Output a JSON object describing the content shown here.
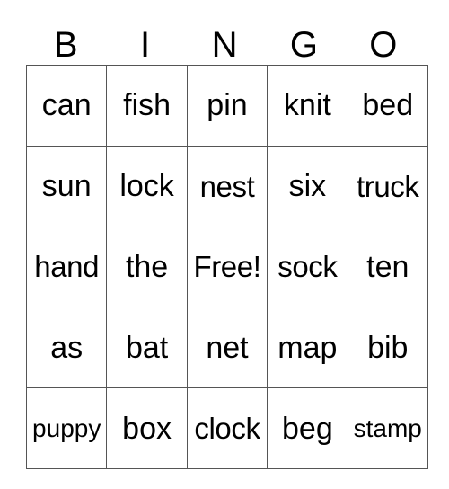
{
  "card": {
    "header_letters": [
      "B",
      "I",
      "N",
      "G",
      "O"
    ],
    "rows": [
      [
        {
          "text": "can",
          "size": "normal"
        },
        {
          "text": "fish",
          "size": "normal"
        },
        {
          "text": "pin",
          "size": "normal"
        },
        {
          "text": "knit",
          "size": "normal"
        },
        {
          "text": "bed",
          "size": "normal"
        }
      ],
      [
        {
          "text": "sun",
          "size": "normal"
        },
        {
          "text": "lock",
          "size": "normal"
        },
        {
          "text": "nest",
          "size": "fit"
        },
        {
          "text": "six",
          "size": "normal"
        },
        {
          "text": "truck",
          "size": "fit"
        }
      ],
      [
        {
          "text": "hand",
          "size": "fit"
        },
        {
          "text": "the",
          "size": "normal"
        },
        {
          "text": "Free!",
          "size": "fit"
        },
        {
          "text": "sock",
          "size": "fit"
        },
        {
          "text": "ten",
          "size": "normal"
        }
      ],
      [
        {
          "text": "as",
          "size": "normal"
        },
        {
          "text": "bat",
          "size": "normal"
        },
        {
          "text": "net",
          "size": "normal"
        },
        {
          "text": "map",
          "size": "normal"
        },
        {
          "text": "bib",
          "size": "normal"
        }
      ],
      [
        {
          "text": "puppy",
          "size": "shrink"
        },
        {
          "text": "box",
          "size": "normal"
        },
        {
          "text": "clock",
          "size": "fit"
        },
        {
          "text": "beg",
          "size": "normal"
        },
        {
          "text": "stamp",
          "size": "shrink"
        }
      ]
    ],
    "free_space_label": "Free!",
    "colors": {
      "background": "#ffffff",
      "text": "#000000",
      "grid_line": "#555555"
    }
  }
}
